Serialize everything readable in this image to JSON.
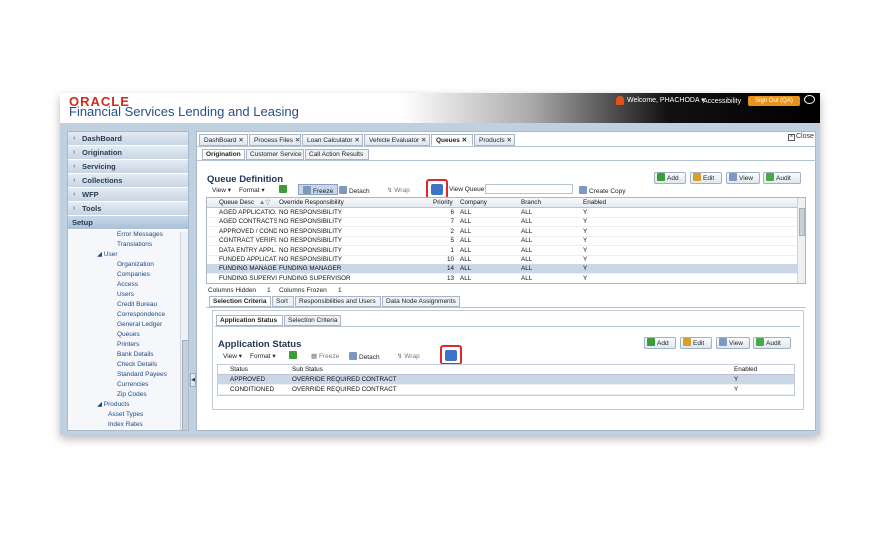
{
  "header": {
    "logo_line1": "ORACLE",
    "logo_line2": "Financial Services Lending and Leasing",
    "welcome": "Welcome, PHACHODA ▾",
    "accessibility": "Accessibility",
    "signout": "Sign Out (QA)"
  },
  "nav": {
    "tabs": [
      "DashBoard",
      "Origination",
      "Servicing",
      "Collections",
      "WFP",
      "Tools",
      "Setup"
    ],
    "tree": [
      "Error Messages",
      "Translations",
      "◢ User",
      "Organization",
      "Companies",
      "Access",
      "Users",
      "Credit Bureau",
      "Correspondence",
      "General Ledger",
      "Queues",
      "Printers",
      "Bank Details",
      "Check Details",
      "Standard Payees",
      "Currencies",
      "Zip Codes",
      "◢ Products",
      "Asset Types",
      "Index Rates"
    ]
  },
  "main": {
    "close": "Close",
    "tabs": [
      "DashBoard",
      "Process Files",
      "Loan Calculator",
      "Vehicle Evaluator",
      "Queues",
      "Products"
    ],
    "subtabs": [
      "Origination",
      "Customer Service",
      "Call Action Results"
    ],
    "queue_title": "Queue Definition",
    "toolbar": {
      "view": "View ▾",
      "format": "Format ▾",
      "freeze": "Freeze",
      "detach": "Detach",
      "wrap": "Wrap",
      "view_queue": "View Queue",
      "create_copy": "Create Copy"
    },
    "buttons": {
      "add": "Add",
      "edit": "Edit",
      "view": "View",
      "audit": "Audit"
    },
    "queue_grid": {
      "headers": [
        "Queue Desc",
        "Override Responsibility",
        "Priority",
        "Company",
        "Branch",
        "Enabled"
      ],
      "rows": [
        [
          "AGED APPLICATIO...",
          "NO RESPONSIBILITY",
          "6",
          "ALL",
          "ALL",
          "Y"
        ],
        [
          "AGED CONTRACTS...",
          "NO RESPONSIBILITY",
          "7",
          "ALL",
          "ALL",
          "Y"
        ],
        [
          "APPROVED / COND...",
          "NO RESPONSIBILITY",
          "2",
          "ALL",
          "ALL",
          "Y"
        ],
        [
          "CONTRACT VERIFI...",
          "NO RESPONSIBILITY",
          "5",
          "ALL",
          "ALL",
          "Y"
        ],
        [
          "DATA ENTRY APPL...",
          "NO RESPONSIBILITY",
          "1",
          "ALL",
          "ALL",
          "Y"
        ],
        [
          "FUNDED APPLICAT...",
          "NO RESPONSIBILITY",
          "10",
          "ALL",
          "ALL",
          "Y"
        ],
        [
          "FUNDING MANAGE...",
          "FUNDING MANAGER",
          "14",
          "ALL",
          "ALL",
          "Y"
        ],
        [
          "FUNDING SUPERVI...",
          "FUNDING SUPERVISOR",
          "13",
          "ALL",
          "ALL",
          "Y"
        ]
      ]
    },
    "columns_hidden": "Columns Hidden",
    "columns_hidden_val": "1",
    "columns_frozen": "Columns Frozen",
    "columns_frozen_val": "1",
    "lower_tabs": [
      "Selection Criteria",
      "Sort",
      "Responsibilities and Users",
      "Data Node Assignments"
    ],
    "lower_subtabs": [
      "Application Status",
      "Selection Criteria"
    ],
    "app_title": "Application Status",
    "app_grid": {
      "headers": [
        "Status",
        "Sub Status",
        "Enabled"
      ],
      "rows": [
        [
          "APPROVED",
          "OVERRIDE REQUIRED CONTRACT",
          "Y"
        ],
        [
          "CONDITIONED",
          "OVERRIDE REQUIRED CONTRACT",
          "Y"
        ]
      ]
    }
  }
}
